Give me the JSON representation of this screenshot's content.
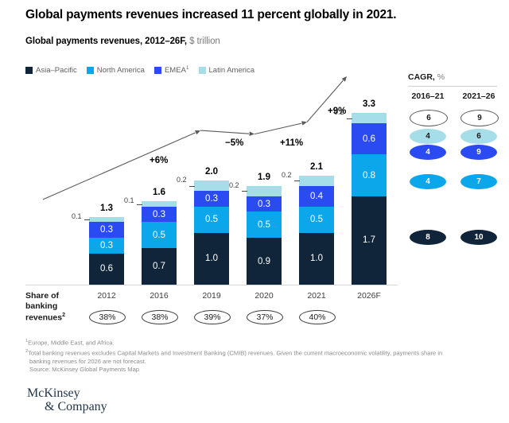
{
  "title": "Global payments revenues increased 11 percent globally in 2021.",
  "subtitle": {
    "main": "Global payments revenues, 2012–26F,",
    "unit": "$ trillion"
  },
  "legend": [
    {
      "label": "Asia–Pacific",
      "color": "#10243a",
      "sup": ""
    },
    {
      "label": "North America",
      "color": "#0ba7ea",
      "sup": ""
    },
    {
      "label": "EMEA",
      "color": "#2b4bf2",
      "sup": "1"
    },
    {
      "label": "Latin America",
      "color": "#a5dee8",
      "sup": ""
    }
  ],
  "share_row": {
    "label_line1": "Share of",
    "label_line2": "banking",
    "label_line3": "revenues",
    "label_sup": "2"
  },
  "cagr": {
    "title": "CAGR,",
    "title_unit": "%",
    "headers": [
      "2016–21",
      "2021–26"
    ],
    "rows": [
      {
        "name": "total",
        "fill": "#ffffff",
        "text": "#1a1a1a",
        "border": "#5a5a5a",
        "values": [
          "6",
          "9"
        ]
      },
      {
        "name": "latin-america",
        "fill": "#a5dee8",
        "text": "#1a1a1a",
        "border": "",
        "values": [
          "4",
          "6"
        ]
      },
      {
        "name": "emea",
        "fill": "#2b4bf2",
        "text": "#ffffff",
        "border": "",
        "values": [
          "4",
          "9"
        ]
      },
      {
        "name": "north-america",
        "fill": "#0ba7ea",
        "text": "#ffffff",
        "border": "",
        "values": [
          "4",
          "7"
        ]
      },
      {
        "name": "asia-pacific",
        "fill": "#10243a",
        "text": "#ffffff",
        "border": "",
        "values": [
          "8",
          "10"
        ]
      }
    ]
  },
  "growth_annotations": [
    {
      "label": "+6%"
    },
    {
      "label": "−5%"
    },
    {
      "label": "+11%"
    },
    {
      "label": "+9%"
    }
  ],
  "footnotes": [
    {
      "sup": "1",
      "text": "Europe, Middle East, and Africa."
    },
    {
      "sup": "2",
      "text": "Total banking revenues excludes Capital Markets and Investment Banking (CMIB) revenues. Given the current macroeconomic volatility, payments share in"
    },
    {
      "sup": "",
      "text": "banking revenues for 2026 are not forecast."
    },
    {
      "sup": "",
      "text": "Source: McKinsey Global Payments Map"
    }
  ],
  "logo": {
    "line1": "McKinsey",
    "line2": "& Company"
  },
  "chart_data": {
    "type": "bar",
    "stacked": true,
    "title": "Global payments revenues increased 11 percent globally in 2021.",
    "subtitle": "Global payments revenues, 2012–26F, $ trillion",
    "xlabel": "",
    "ylabel": "$ trillion",
    "ylim": [
      0,
      3.3
    ],
    "grid": false,
    "legend_position": "top-left",
    "categories": [
      "2012",
      "2016",
      "2019",
      "2020",
      "2021",
      "2026F"
    ],
    "totals": [
      "1.3",
      "1.6",
      "2.0",
      "1.9",
      "2.1",
      "3.3"
    ],
    "share_of_banking_revenues": [
      "38%",
      "38%",
      "39%",
      "37%",
      "40%",
      ""
    ],
    "series": [
      {
        "name": "Asia–Pacific",
        "color": "#10243a",
        "values": [
          "0.6",
          "0.7",
          "1.0",
          "0.9",
          "1.0",
          "1.7"
        ]
      },
      {
        "name": "North America",
        "color": "#0ba7ea",
        "values": [
          "0.3",
          "0.5",
          "0.5",
          "0.5",
          "0.5",
          "0.8"
        ]
      },
      {
        "name": "EMEA",
        "color": "#2b4bf2",
        "values": [
          "0.3",
          "0.3",
          "0.3",
          "0.3",
          "0.4",
          "0.6"
        ]
      },
      {
        "name": "Latin America",
        "color": "#a5dee8",
        "values": [
          "0.1",
          "0.1",
          "0.2",
          "0.2",
          "0.2",
          "0.2"
        ]
      }
    ],
    "growth_between": [
      {
        "from": "2012",
        "to": "2019",
        "label": "+6%"
      },
      {
        "from": "2019",
        "to": "2020",
        "label": "−5%"
      },
      {
        "from": "2020",
        "to": "2021",
        "label": "+11%"
      },
      {
        "from": "2021",
        "to": "2026F",
        "label": "+9%"
      }
    ],
    "cagr_2016_21": {
      "total": "6",
      "Latin America": "4",
      "EMEA": "4",
      "North America": "4",
      "Asia–Pacific": "8"
    },
    "cagr_2021_26": {
      "total": "9",
      "Latin America": "6",
      "EMEA": "9",
      "North America": "7",
      "Asia–Pacific": "10"
    }
  }
}
